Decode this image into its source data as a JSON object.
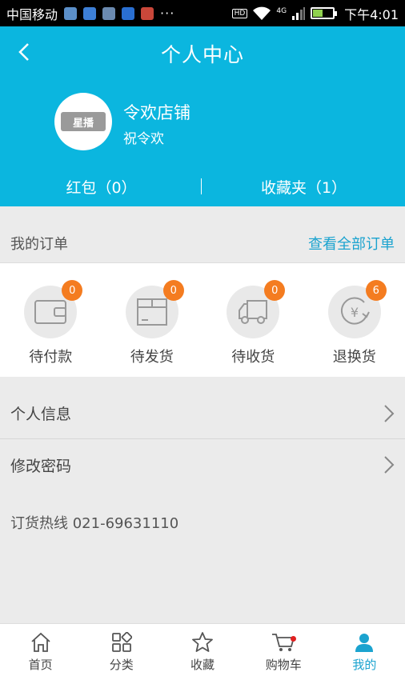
{
  "status_bar": {
    "carrier": "中国移动",
    "more": "···",
    "hd": "HD",
    "network": "4G",
    "time": "下午4:01"
  },
  "header": {
    "title": "个人中心",
    "avatar_text": "星播",
    "shop_name": "令欢店铺",
    "owner_name": "祝令欢",
    "red_packet": "红包（0）",
    "favorites": "收藏夹（1）"
  },
  "orders": {
    "title": "我的订单",
    "view_all": "查看全部订单",
    "items": [
      {
        "label": "待付款",
        "count": "0",
        "icon": "wallet-icon"
      },
      {
        "label": "待发货",
        "count": "0",
        "icon": "package-icon"
      },
      {
        "label": "待收货",
        "count": "0",
        "icon": "truck-icon"
      },
      {
        "label": "退换货",
        "count": "6",
        "icon": "refund-icon"
      }
    ]
  },
  "menu": {
    "personal_info": "个人信息",
    "change_password": "修改密码",
    "hotline": "订货热线 021-69631110"
  },
  "tabbar": {
    "items": [
      {
        "label": "首页",
        "icon": "home-icon"
      },
      {
        "label": "分类",
        "icon": "category-icon"
      },
      {
        "label": "收藏",
        "icon": "star-icon"
      },
      {
        "label": "购物车",
        "icon": "cart-icon"
      },
      {
        "label": "我的",
        "icon": "user-icon"
      }
    ],
    "active": "我的"
  },
  "colors": {
    "primary": "#0bb6df",
    "accent_link": "#1ba3cf",
    "badge": "#f47c20",
    "cart_dot": "#e02020"
  }
}
